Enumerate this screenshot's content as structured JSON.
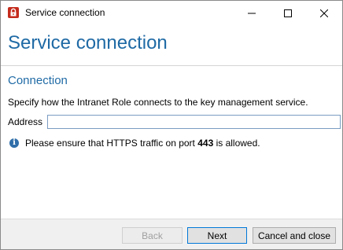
{
  "window": {
    "title": "Service connection",
    "icon": "lock-icon",
    "controls": {
      "minimize": "minimize-icon",
      "maximize": "maximize-icon",
      "close": "close-icon"
    }
  },
  "header": {
    "title": "Service connection"
  },
  "section": {
    "title": "Connection",
    "description": "Specify how the Intranet Role connects to the key management service."
  },
  "address": {
    "label": "Address",
    "value": "",
    "placeholder": ""
  },
  "info": {
    "icon": "info-icon",
    "text_before": "Please ensure that HTTPS traffic on port ",
    "port": "443",
    "text_after": " is allowed."
  },
  "footer": {
    "back_label": "Back",
    "next_label": "Next",
    "close_label": "Cancel and close"
  },
  "colors": {
    "accent": "#1f6aa5",
    "app_icon": "#c42b1c",
    "info_icon": "#2f6ea9",
    "focus_border": "#0078d7"
  }
}
